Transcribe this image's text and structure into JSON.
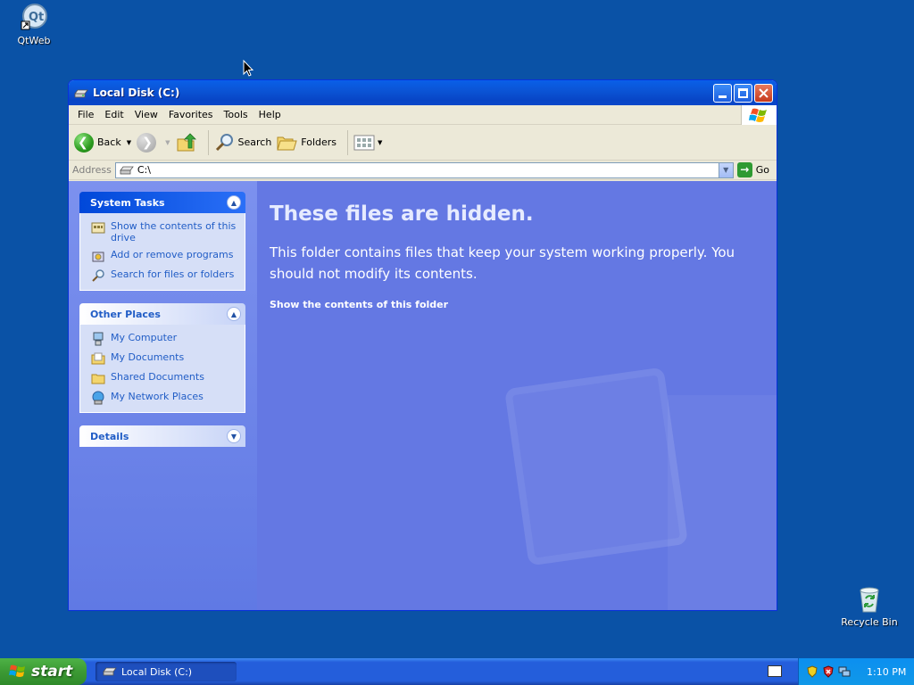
{
  "desktop": {
    "icons": [
      {
        "label": "QtWeb"
      },
      {
        "label": "Recycle Bin"
      }
    ]
  },
  "window": {
    "title": "Local Disk (C:)",
    "menu": [
      "File",
      "Edit",
      "View",
      "Favorites",
      "Tools",
      "Help"
    ],
    "toolbar": {
      "back_label": "Back",
      "search_label": "Search",
      "folders_label": "Folders"
    },
    "address": {
      "label": "Address",
      "value": "C:\\",
      "go_label": "Go"
    },
    "taskpane": {
      "system_tasks": {
        "title": "System Tasks",
        "items": [
          "Show the contents of this drive",
          "Add or remove programs",
          "Search for files or folders"
        ]
      },
      "other_places": {
        "title": "Other Places",
        "items": [
          "My Computer",
          "My Documents",
          "Shared Documents",
          "My Network Places"
        ]
      },
      "details": {
        "title": "Details"
      }
    },
    "main": {
      "heading": "These files are hidden.",
      "message": "This folder contains files that keep your system working properly. You should not modify its contents.",
      "link": "Show the contents of this folder"
    }
  },
  "taskbar": {
    "start_label": "start",
    "task_button": "Local Disk (C:)",
    "clock": "1:10 PM"
  },
  "colors": {
    "desktop": "#0a52a6",
    "titlebar": "#0845c6",
    "taskpane_link": "#215dc6",
    "main_pane": "#6478e3",
    "start_button": "#3c9a34"
  }
}
